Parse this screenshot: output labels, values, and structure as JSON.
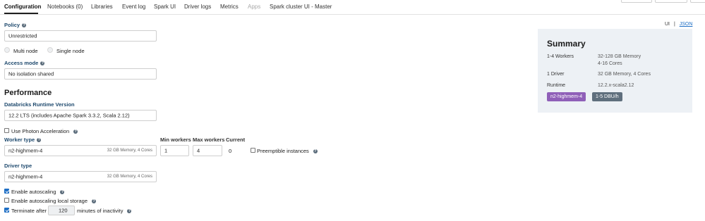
{
  "tabs": [
    {
      "label": "Configuration",
      "state": "active"
    },
    {
      "label": "Notebooks (0)",
      "state": "normal"
    },
    {
      "label": "Libraries",
      "state": "normal"
    },
    {
      "label": "Event log",
      "state": "normal"
    },
    {
      "label": "Spark UI",
      "state": "normal"
    },
    {
      "label": "Driver logs",
      "state": "normal"
    },
    {
      "label": "Metrics",
      "state": "normal"
    },
    {
      "label": "Apps",
      "state": "disabled"
    },
    {
      "label": "Spark cluster UI - Master",
      "state": "normal"
    }
  ],
  "view_toggle": {
    "ui": "UI",
    "separator": "|",
    "json": "JSON"
  },
  "policy": {
    "label": "Policy",
    "value": "Unrestricted"
  },
  "node_mode": {
    "multi": "Multi node",
    "single": "Single node"
  },
  "access_mode": {
    "label": "Access mode",
    "value": "No isolation shared"
  },
  "performance": {
    "heading": "Performance",
    "runtime_label": "Databricks Runtime Version",
    "runtime_value": "12.2 LTS (includes Apache Spark 3.3.2, Scala 2.12)",
    "photon_label": "Use Photon Acceleration",
    "photon_checked": false
  },
  "workers": {
    "type_label": "Worker type",
    "type_value": "n2-highmem-4",
    "type_hint": "32 GB Memory, 4 Cores",
    "min_label": "Min workers",
    "min_value": "1",
    "max_label": "Max workers",
    "max_value": "4",
    "current_label": "Current",
    "current_value": "0",
    "preemptible_label": "Preemptible instances",
    "preemptible_checked": false
  },
  "driver": {
    "type_label": "Driver type",
    "type_value": "n2-highmem-4",
    "type_hint": "32 GB Memory, 4 Cores"
  },
  "options": {
    "autoscaling_label": "Enable autoscaling",
    "autoscaling_checked": true,
    "local_storage_label": "Enable autoscaling local storage",
    "local_storage_checked": false,
    "terminate_label": "Terminate after",
    "terminate_checked": true,
    "terminate_value": "120",
    "terminate_suffix": "minutes of inactivity"
  },
  "summary": {
    "title": "Summary",
    "workers_key": "1-4 Workers",
    "workers_memory": "32-128 GB Memory",
    "workers_cores": "4-16 Cores",
    "driver_key": "1 Driver",
    "driver_value": "32 GB Memory, 4 Cores",
    "runtime_key": "Runtime",
    "runtime_value": "12.2.x-scala2.12",
    "badge_instance": "n2-highmem-4",
    "badge_dbu": "1-5 DBU/h"
  },
  "colors": {
    "accent": "#1f6fc5",
    "badge_instance": "#8f5fb8",
    "badge_dbu": "#5f6f7d",
    "summary_bg": "#edf1f5"
  }
}
